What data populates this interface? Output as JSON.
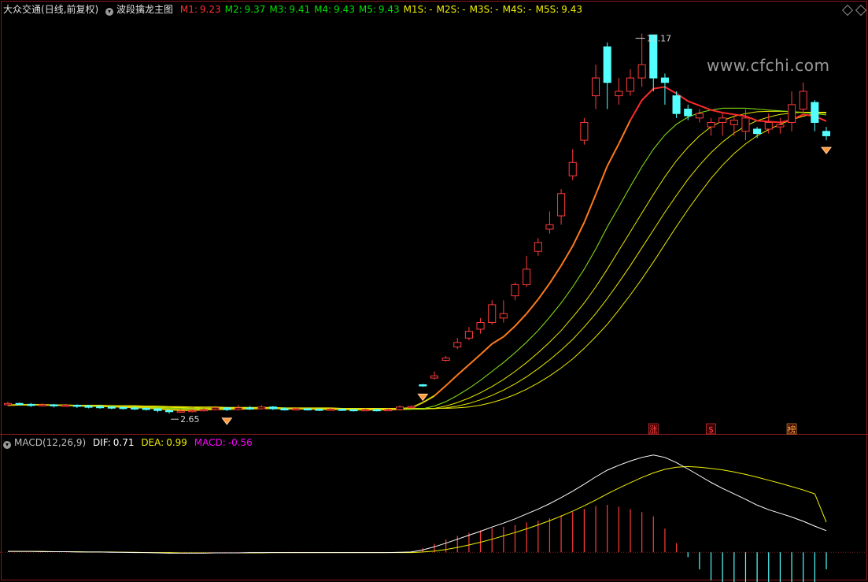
{
  "header": {
    "stock_name": "大众交通",
    "period": "(日线,前复权)",
    "indicator_name": "波段擒龙主图",
    "values": [
      {
        "label": "M1:",
        "value": "9.23",
        "color": "#ff3030"
      },
      {
        "label": "M2:",
        "value": "9.37",
        "color": "#00e000"
      },
      {
        "label": "M3:",
        "value": "9.41",
        "color": "#00e000"
      },
      {
        "label": "M4:",
        "value": "9.43",
        "color": "#00e000"
      },
      {
        "label": "M5:",
        "value": "9.43",
        "color": "#00e000"
      },
      {
        "label": "M1S:",
        "value": "-",
        "color": "#f0f000"
      },
      {
        "label": "M2S:",
        "value": "-",
        "color": "#f0f000"
      },
      {
        "label": "M3S:",
        "value": "-",
        "color": "#f0f000"
      },
      {
        "label": "M4S:",
        "value": "-",
        "color": "#f0f000"
      },
      {
        "label": "M5S:",
        "value": "9.43",
        "color": "#f0f000"
      }
    ]
  },
  "macd_header": {
    "name": "MACD(12,26,9)",
    "dif_label": "DIF:",
    "dif_value": "0.71",
    "dea_label": "DEA:",
    "dea_value": "0.99",
    "macd_label": "MACD:",
    "macd_value": "-0.56"
  },
  "watermark": "www.cfchi.com",
  "annotations": {
    "high": "11.17",
    "low": "2.65"
  },
  "event_labels": [
    "涨",
    "$",
    "榜"
  ],
  "colors": {
    "up": "#ff3c3c",
    "down": "#54ffff",
    "m1": "#ff2a2a",
    "band": "#f0f000",
    "dif": "#ffffff",
    "dea": "#f0f000",
    "macd_neg": "#ff00ff"
  },
  "chart_data": [
    {
      "type": "candlestick",
      "title": "波段擒龙主图",
      "ylim": [
        2.3,
        11.6
      ],
      "candles": [
        [
          2.85,
          2.88,
          2.92,
          2.82
        ],
        [
          2.88,
          2.86,
          2.9,
          2.83
        ],
        [
          2.86,
          2.84,
          2.89,
          2.8
        ],
        [
          2.84,
          2.85,
          2.88,
          2.81
        ],
        [
          2.85,
          2.83,
          2.87,
          2.79
        ],
        [
          2.83,
          2.84,
          2.87,
          2.8
        ],
        [
          2.84,
          2.82,
          2.86,
          2.78
        ],
        [
          2.82,
          2.81,
          2.85,
          2.77
        ],
        [
          2.81,
          2.8,
          2.84,
          2.76
        ],
        [
          2.8,
          2.79,
          2.83,
          2.75
        ],
        [
          2.79,
          2.78,
          2.82,
          2.74
        ],
        [
          2.78,
          2.77,
          2.81,
          2.73
        ],
        [
          2.77,
          2.76,
          2.8,
          2.72
        ],
        [
          2.76,
          2.72,
          2.78,
          2.68
        ],
        [
          2.72,
          2.7,
          2.75,
          2.65
        ],
        [
          2.7,
          2.71,
          2.74,
          2.67
        ],
        [
          2.71,
          2.72,
          2.75,
          2.68
        ],
        [
          2.72,
          2.74,
          2.78,
          2.7
        ],
        [
          2.74,
          2.78,
          2.82,
          2.72
        ],
        [
          2.78,
          2.74,
          2.8,
          2.71
        ],
        [
          2.74,
          2.78,
          2.85,
          2.72
        ],
        [
          2.78,
          2.76,
          2.82,
          2.73
        ],
        [
          2.76,
          2.8,
          2.84,
          2.74
        ],
        [
          2.8,
          2.76,
          2.82,
          2.73
        ],
        [
          2.76,
          2.75,
          2.79,
          2.72
        ],
        [
          2.75,
          2.76,
          2.79,
          2.72
        ],
        [
          2.76,
          2.75,
          2.78,
          2.72
        ],
        [
          2.75,
          2.74,
          2.77,
          2.71
        ],
        [
          2.74,
          2.75,
          2.78,
          2.72
        ],
        [
          2.75,
          2.74,
          2.77,
          2.71
        ],
        [
          2.74,
          2.73,
          2.76,
          2.7
        ],
        [
          2.73,
          2.74,
          2.77,
          2.71
        ],
        [
          2.74,
          2.73,
          2.76,
          2.7
        ],
        [
          2.73,
          2.74,
          2.77,
          2.71
        ],
        [
          2.74,
          2.8,
          2.84,
          2.72
        ],
        [
          2.8,
          2.81,
          2.84,
          2.78
        ],
        [
          3.3,
          3.28,
          3.32,
          3.25
        ],
        [
          3.45,
          3.5,
          3.6,
          3.42
        ],
        [
          3.85,
          3.9,
          3.95,
          3.82
        ],
        [
          4.15,
          4.25,
          4.35,
          4.1
        ],
        [
          4.35,
          4.5,
          4.6,
          4.3
        ],
        [
          4.55,
          4.7,
          4.8,
          4.45
        ],
        [
          4.7,
          5.1,
          5.2,
          4.65
        ],
        [
          4.8,
          4.9,
          5.2,
          4.7
        ],
        [
          5.3,
          5.55,
          5.6,
          5.2
        ],
        [
          5.55,
          5.9,
          6.2,
          5.5
        ],
        [
          6.3,
          6.5,
          6.6,
          6.2
        ],
        [
          6.8,
          6.9,
          7.2,
          6.7
        ],
        [
          7.1,
          7.6,
          7.7,
          6.9
        ],
        [
          8.0,
          8.3,
          8.6,
          7.9
        ],
        [
          8.8,
          9.2,
          9.3,
          8.7
        ],
        [
          9.8,
          10.2,
          10.5,
          9.5
        ],
        [
          10.9,
          10.1,
          11.0,
          9.5
        ],
        [
          9.8,
          9.9,
          10.2,
          9.6
        ],
        [
          9.9,
          10.2,
          10.4,
          9.8
        ],
        [
          10.2,
          10.5,
          11.2,
          10.0
        ],
        [
          11.17,
          10.2,
          11.17,
          9.9
        ],
        [
          10.2,
          10.1,
          10.3,
          9.6
        ],
        [
          9.8,
          9.4,
          9.9,
          9.3
        ],
        [
          9.5,
          9.35,
          9.6,
          9.25
        ],
        [
          9.3,
          9.4,
          9.5,
          9.2
        ],
        [
          9.1,
          9.2,
          9.3,
          8.9
        ],
        [
          9.2,
          9.3,
          9.4,
          8.9
        ],
        [
          9.15,
          9.25,
          9.35,
          8.9
        ],
        [
          9.0,
          9.3,
          9.5,
          8.8
        ],
        [
          9.05,
          8.95,
          9.1,
          8.85
        ],
        [
          9.05,
          9.2,
          9.4,
          8.95
        ],
        [
          9.1,
          9.15,
          9.3,
          8.95
        ],
        [
          9.2,
          9.6,
          9.9,
          9.0
        ],
        [
          9.5,
          9.9,
          10.1,
          9.4
        ],
        [
          9.65,
          9.2,
          9.7,
          9.0
        ],
        [
          9.0,
          8.9,
          9.1,
          8.8
        ]
      ],
      "lines": {
        "M1": [
          2.84,
          2.85,
          2.85,
          2.85,
          2.84,
          2.84,
          2.83,
          2.82,
          2.82,
          2.81,
          2.8,
          2.79,
          2.78,
          2.76,
          2.74,
          2.73,
          2.73,
          2.74,
          2.75,
          2.75,
          2.76,
          2.76,
          2.77,
          2.77,
          2.76,
          2.76,
          2.76,
          2.75,
          2.75,
          2.75,
          2.74,
          2.74,
          2.74,
          2.74,
          2.76,
          2.78,
          2.9,
          3.05,
          3.28,
          3.52,
          3.75,
          3.98,
          4.22,
          4.38,
          4.62,
          4.9,
          5.22,
          5.58,
          5.98,
          6.42,
          6.95,
          7.58,
          8.22,
          8.72,
          9.25,
          9.7,
          9.96,
          10.0,
          9.85,
          9.68,
          9.58,
          9.48,
          9.42,
          9.38,
          9.34,
          9.24,
          9.22,
          9.2,
          9.26,
          9.38,
          9.34,
          9.23
        ],
        "M2": [
          2.84,
          2.84,
          2.84,
          2.84,
          2.84,
          2.84,
          2.83,
          2.83,
          2.82,
          2.82,
          2.81,
          2.8,
          2.79,
          2.78,
          2.77,
          2.76,
          2.76,
          2.76,
          2.76,
          2.76,
          2.76,
          2.76,
          2.76,
          2.76,
          2.76,
          2.76,
          2.76,
          2.76,
          2.75,
          2.75,
          2.75,
          2.75,
          2.74,
          2.74,
          2.74,
          2.75,
          2.76,
          2.82,
          2.92,
          3.06,
          3.22,
          3.4,
          3.6,
          3.8,
          4.02,
          4.26,
          4.52,
          4.82,
          5.14,
          5.5,
          5.9,
          6.35,
          6.85,
          7.3,
          7.76,
          8.2,
          8.6,
          8.92,
          9.16,
          9.32,
          9.42,
          9.48,
          9.52,
          9.52,
          9.52,
          9.5,
          9.48,
          9.46,
          9.44,
          9.42,
          9.4,
          9.37
        ],
        "M3": [
          2.84,
          2.84,
          2.84,
          2.84,
          2.84,
          2.84,
          2.84,
          2.83,
          2.83,
          2.82,
          2.82,
          2.81,
          2.8,
          2.79,
          2.78,
          2.78,
          2.77,
          2.77,
          2.77,
          2.77,
          2.77,
          2.77,
          2.77,
          2.77,
          2.77,
          2.76,
          2.76,
          2.76,
          2.76,
          2.76,
          2.76,
          2.75,
          2.75,
          2.75,
          2.75,
          2.75,
          2.75,
          2.77,
          2.82,
          2.9,
          3.0,
          3.12,
          3.26,
          3.42,
          3.6,
          3.8,
          4.02,
          4.26,
          4.52,
          4.82,
          5.14,
          5.5,
          5.9,
          6.32,
          6.74,
          7.16,
          7.58,
          7.98,
          8.34,
          8.64,
          8.9,
          9.1,
          9.24,
          9.34,
          9.4,
          9.44,
          9.45,
          9.45,
          9.44,
          9.43,
          9.42,
          9.41
        ],
        "M4": [
          2.84,
          2.84,
          2.84,
          2.84,
          2.84,
          2.84,
          2.84,
          2.84,
          2.83,
          2.83,
          2.82,
          2.82,
          2.81,
          2.8,
          2.8,
          2.79,
          2.79,
          2.78,
          2.78,
          2.78,
          2.78,
          2.78,
          2.78,
          2.78,
          2.77,
          2.77,
          2.77,
          2.77,
          2.77,
          2.76,
          2.76,
          2.76,
          2.76,
          2.76,
          2.76,
          2.76,
          2.76,
          2.76,
          2.78,
          2.82,
          2.88,
          2.96,
          3.06,
          3.18,
          3.32,
          3.48,
          3.66,
          3.86,
          4.08,
          4.32,
          4.6,
          4.9,
          5.24,
          5.6,
          5.98,
          6.38,
          6.78,
          7.18,
          7.56,
          7.92,
          8.24,
          8.52,
          8.76,
          8.96,
          9.12,
          9.24,
          9.32,
          9.38,
          9.41,
          9.43,
          9.43,
          9.43
        ],
        "M5": [
          2.84,
          2.84,
          2.84,
          2.84,
          2.84,
          2.84,
          2.84,
          2.84,
          2.84,
          2.83,
          2.83,
          2.83,
          2.82,
          2.82,
          2.81,
          2.81,
          2.8,
          2.8,
          2.8,
          2.79,
          2.79,
          2.79,
          2.79,
          2.79,
          2.78,
          2.78,
          2.78,
          2.78,
          2.78,
          2.77,
          2.77,
          2.77,
          2.77,
          2.77,
          2.77,
          2.77,
          2.77,
          2.77,
          2.77,
          2.78,
          2.8,
          2.84,
          2.9,
          2.98,
          3.08,
          3.2,
          3.34,
          3.5,
          3.68,
          3.88,
          4.12,
          4.38,
          4.66,
          4.98,
          5.32,
          5.68,
          6.06,
          6.46,
          6.86,
          7.24,
          7.6,
          7.94,
          8.24,
          8.5,
          8.72,
          8.9,
          9.04,
          9.16,
          9.26,
          9.34,
          9.4,
          9.43
        ]
      },
      "signal_bars": [
        19,
        36,
        71
      ],
      "event_bars": [
        56,
        61,
        68
      ]
    },
    {
      "type": "bar",
      "title": "MACD(12,26,9)",
      "ylim": [
        -0.9,
        3.4
      ],
      "dif": [
        0.03,
        0.03,
        0.03,
        0.02,
        0.02,
        0.02,
        0.01,
        0.01,
        0.01,
        0.0,
        0.0,
        -0.01,
        -0.01,
        -0.02,
        -0.03,
        -0.03,
        -0.03,
        -0.03,
        -0.02,
        -0.02,
        -0.02,
        -0.01,
        -0.01,
        -0.01,
        -0.01,
        -0.01,
        -0.01,
        -0.01,
        -0.01,
        -0.01,
        -0.01,
        -0.01,
        -0.01,
        -0.01,
        0.0,
        0.01,
        0.08,
        0.18,
        0.3,
        0.43,
        0.56,
        0.69,
        0.83,
        0.96,
        1.1,
        1.26,
        1.42,
        1.6,
        1.8,
        2.01,
        2.24,
        2.48,
        2.7,
        2.86,
        3.0,
        3.12,
        3.2,
        3.12,
        2.95,
        2.74,
        2.52,
        2.3,
        2.1,
        1.92,
        1.74,
        1.55,
        1.4,
        1.28,
        1.16,
        1.02,
        0.86,
        0.71
      ],
      "dea": [
        0.03,
        0.03,
        0.03,
        0.03,
        0.02,
        0.02,
        0.02,
        0.01,
        0.01,
        0.01,
        0.0,
        0.0,
        -0.01,
        -0.01,
        -0.01,
        -0.02,
        -0.02,
        -0.02,
        -0.02,
        -0.02,
        -0.02,
        -0.02,
        -0.02,
        -0.01,
        -0.01,
        -0.01,
        -0.01,
        -0.01,
        -0.01,
        -0.01,
        -0.01,
        -0.01,
        -0.01,
        -0.01,
        -0.01,
        -0.01,
        0.01,
        0.04,
        0.09,
        0.16,
        0.24,
        0.33,
        0.43,
        0.54,
        0.65,
        0.77,
        0.9,
        1.04,
        1.19,
        1.35,
        1.53,
        1.72,
        1.92,
        2.11,
        2.29,
        2.46,
        2.61,
        2.73,
        2.8,
        2.82,
        2.8,
        2.76,
        2.71,
        2.64,
        2.56,
        2.47,
        2.37,
        2.27,
        2.16,
        2.05,
        1.92,
        0.99
      ]
    }
  ]
}
